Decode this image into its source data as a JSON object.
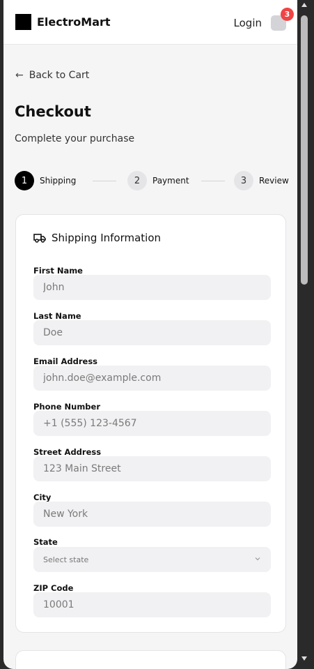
{
  "header": {
    "brand": "ElectroMart",
    "login_label": "Login",
    "cart_count": "3"
  },
  "nav": {
    "back_label": "Back to Cart"
  },
  "page": {
    "title": "Checkout",
    "subtitle": "Complete your purchase"
  },
  "steps": [
    {
      "number": "1",
      "label": "Shipping",
      "active": true
    },
    {
      "number": "2",
      "label": "Payment",
      "active": false
    },
    {
      "number": "3",
      "label": "Review",
      "active": false
    }
  ],
  "shipping": {
    "section_title": "Shipping Information",
    "icon": "truck-icon",
    "fields": {
      "first_name": {
        "label": "First Name",
        "placeholder": "John"
      },
      "last_name": {
        "label": "Last Name",
        "placeholder": "Doe"
      },
      "email": {
        "label": "Email Address",
        "placeholder": "john.doe@example.com"
      },
      "phone": {
        "label": "Phone Number",
        "placeholder": "+1 (555) 123-4567"
      },
      "street": {
        "label": "Street Address",
        "placeholder": "123 Main Street"
      },
      "city": {
        "label": "City",
        "placeholder": "New York"
      },
      "state": {
        "label": "State",
        "placeholder": "Select state"
      },
      "zip": {
        "label": "ZIP Code",
        "placeholder": "10001"
      }
    }
  },
  "colors": {
    "accent": "#000000",
    "badge": "#ef4444",
    "input_bg": "#f1f1f3",
    "page_bg": "#f5f5f6"
  }
}
